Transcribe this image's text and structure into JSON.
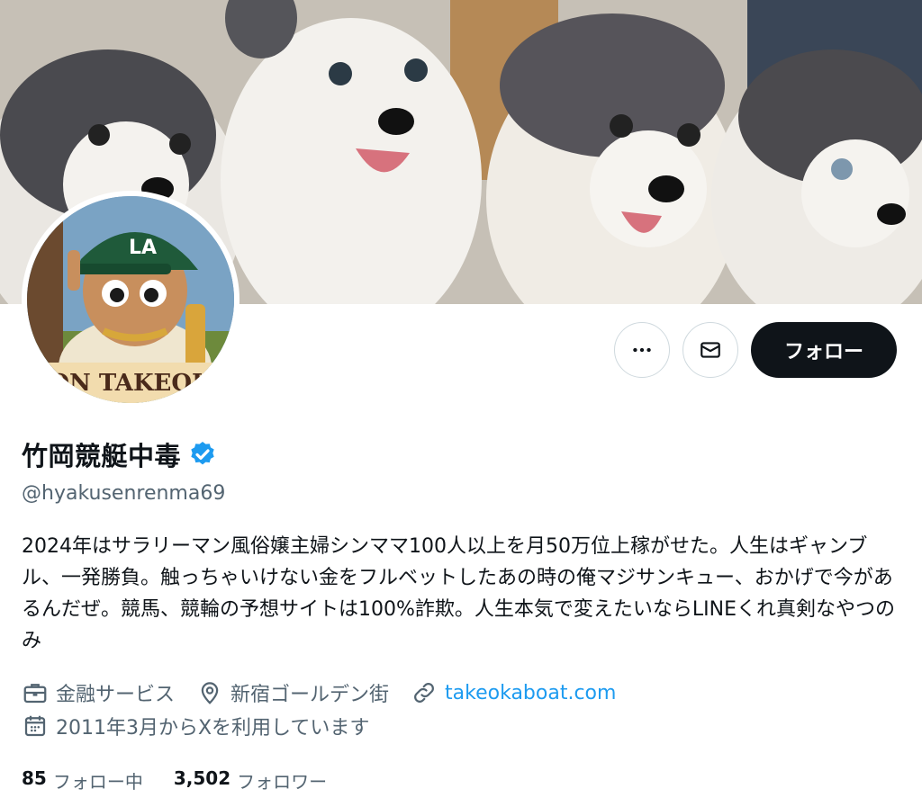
{
  "profile": {
    "display_name": "竹岡競艇中毒",
    "handle": "@hyakusenrenma69",
    "bio": "2024年はサラリーマン風俗嬢主婦シンママ100人以上を月50万位上稼がせた。人生はギャンブル、一発勝負。触っちゃいけない金をフルベットしたあの時の俺マジサンキュー、おかげで今があるんだぜ。競馬、競輪の予想サイトは100%詐欺。人生本気で変えたいならLINEくれ真剣なやつのみ",
    "category": "金融サービス",
    "location": "新宿ゴールデン街",
    "website": "takeokaboat.com",
    "joined": "2011年3月からXを利用しています",
    "avatar_text": "ON TAKEOK",
    "avatar_cap_text": "LA"
  },
  "actions": {
    "more_icon": "more-icon",
    "message_icon": "mail-icon",
    "follow_label": "フォロー"
  },
  "stats": {
    "following_count": "85",
    "following_label": "フォロー中",
    "followers_count": "3,502",
    "followers_label": "フォロワー"
  },
  "colors": {
    "accent": "#1d9bf0",
    "text": "#0f1419",
    "secondary": "#536471",
    "follow_button": "#0f1419"
  }
}
